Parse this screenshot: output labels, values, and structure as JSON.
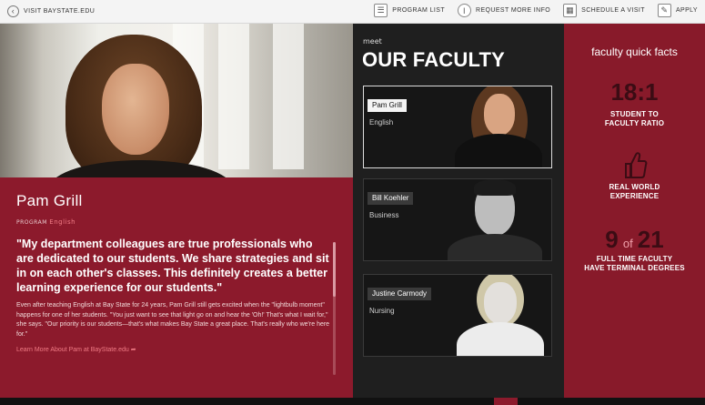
{
  "topbar": {
    "visit_label": "VISIT BAYSTATE.EDU",
    "nav": [
      {
        "label": "PROGRAM LIST",
        "icon": "list-icon"
      },
      {
        "label": "REQUEST MORE INFO",
        "icon": "info-icon"
      },
      {
        "label": "SCHEDULE A VISIT",
        "icon": "calendar-icon"
      },
      {
        "label": "APPLY",
        "icon": "pencil-icon"
      }
    ]
  },
  "bio": {
    "name": "Pam Grill",
    "program_label": "PROGRAM",
    "program_value": "English",
    "quote": "\"My department colleagues are true professionals who are dedicated to our students. We share strategies and sit in on each other's classes. This definitely creates a better learning experience for our students.\"",
    "paragraph": "Even after teaching English at Bay State for 24 years, Pam Grill still gets excited when the \"lightbulb moment\" happens for one of her students. \"You just want to see that light go on and hear the 'Oh!' That's what I wait for,\" she says. \"Our priority is our students—that's what makes Bay State a great place. That's really who we're here for.\"",
    "learn_more": "Learn More About Pam at BayState.edu"
  },
  "faculty": {
    "meet": "meet",
    "title": "OUR FACULTY",
    "cards": [
      {
        "name": "Pam Grill",
        "dept": "English"
      },
      {
        "name": "Bill Koehler",
        "dept": "Business"
      },
      {
        "name": "Justine Carmody",
        "dept": "Nursing"
      }
    ]
  },
  "stats": {
    "title": "faculty quick facts",
    "ratio": "18:1",
    "ratio_label_1": "STUDENT TO",
    "ratio_label_2": "FACULTY RATIO",
    "experience_label_1": "REAL WORLD",
    "experience_label_2": "EXPERIENCE",
    "count": "9",
    "of": "of",
    "total": "21",
    "count_label_1": "FULL TIME FACULTY",
    "count_label_2": "HAVE TERMINAL DEGREES"
  },
  "colors": {
    "accent_red": "#8c1a2c",
    "dark_red": "#3b0c14",
    "pink_link": "#f07b85",
    "panel_dark": "#1f1f1f"
  }
}
